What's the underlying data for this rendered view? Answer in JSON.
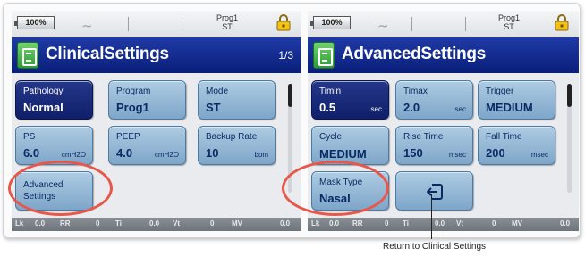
{
  "colors": {
    "accent_blue": "#0a1f7a",
    "tile_blue": "#8fb3d3",
    "highlight_ring": "#e8574a",
    "icon_green": "#3aa845"
  },
  "left": {
    "status": {
      "battery": "100%",
      "prog_line1": "Prog1",
      "prog_line2": "ST",
      "icons": [
        "battery-icon",
        "wave-icon",
        "lock-icon"
      ]
    },
    "title": "ClinicalSettings",
    "page": "1/3",
    "tiles": [
      {
        "label": "Pathology",
        "value": "Normal",
        "unit": "",
        "selected": true
      },
      {
        "label": "Program",
        "value": "Prog1",
        "unit": ""
      },
      {
        "label": "Mode",
        "value": "ST",
        "unit": ""
      },
      {
        "label": "PS",
        "value": "6.0",
        "unit": "cmH2O"
      },
      {
        "label": "PEEP",
        "value": "4.0",
        "unit": "cmH2O"
      },
      {
        "label": "Backup Rate",
        "value": "10",
        "unit": "bpm"
      }
    ],
    "advanced": {
      "line1": "Advanced",
      "line2": "Settings"
    },
    "monitor": [
      {
        "k": "Lk",
        "v": "0.0"
      },
      {
        "k": "RR",
        "v": "0"
      },
      {
        "k": "Ti",
        "v": "0.0"
      },
      {
        "k": "Vt",
        "v": "0"
      },
      {
        "k": "MV",
        "v": "0.0"
      }
    ]
  },
  "right": {
    "status": {
      "battery": "100%",
      "prog_line1": "Prog1",
      "prog_line2": "ST"
    },
    "title": "AdvancedSettings",
    "tiles": [
      {
        "label": "Timin",
        "value": "0.5",
        "unit": "sec",
        "selected": true
      },
      {
        "label": "Timax",
        "value": "2.0",
        "unit": "sec"
      },
      {
        "label": "Trigger",
        "value": "MEDIUM",
        "unit": ""
      },
      {
        "label": "Cycle",
        "value": "MEDIUM",
        "unit": ""
      },
      {
        "label": "Rise Time",
        "value": "150",
        "unit": "msec"
      },
      {
        "label": "Fall Time",
        "value": "200",
        "unit": "msec"
      },
      {
        "label": "Mask Type",
        "value": "Nasal",
        "unit": ""
      }
    ],
    "back_icon": "return-icon",
    "monitor": [
      {
        "k": "Lk",
        "v": "0.0"
      },
      {
        "k": "RR",
        "v": "0"
      },
      {
        "k": "Ti",
        "v": "0.0"
      },
      {
        "k": "Vt",
        "v": "0"
      },
      {
        "k": "MV",
        "v": "0.0"
      }
    ]
  },
  "caption": "Return to Clinical Settings"
}
